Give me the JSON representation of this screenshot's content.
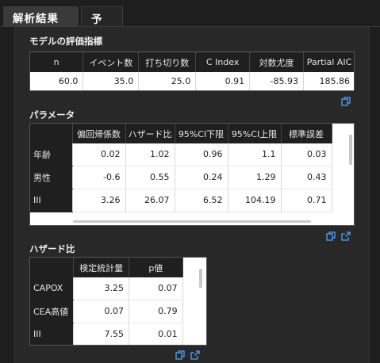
{
  "tabs": [
    {
      "label": "解析結果"
    },
    {
      "label": "予測"
    }
  ],
  "model_metrics": {
    "title": "モデルの評価指標",
    "columns": [
      "n",
      "イベント数",
      "打ち切り数",
      "C Index",
      "対数尤度",
      "Partial AIC"
    ],
    "row": [
      "60.0",
      "35.0",
      "25.0",
      "0.91",
      "-85.93",
      "185.86"
    ]
  },
  "parameters": {
    "title": "パラメータ",
    "columns": [
      "",
      "偏回帰係数",
      "ハザード比",
      "95%CI下限",
      "95%CI上限",
      "標準誤差"
    ],
    "rows": [
      [
        "年齢",
        "0.02",
        "1.02",
        "0.96",
        "1.1",
        "0.03"
      ],
      [
        "男性",
        "-0.6",
        "0.55",
        "0.24",
        "1.29",
        "0.43"
      ],
      [
        "III",
        "3.26",
        "26.07",
        "6.52",
        "104.19",
        "0.71"
      ]
    ]
  },
  "hazard": {
    "title": "ハザード比",
    "columns": [
      "",
      "検定統計量",
      "p値"
    ],
    "rows": [
      [
        "CAPOX",
        "3.25",
        "0.07"
      ],
      [
        "CEA高値",
        "0.07",
        "0.79"
      ],
      [
        "III",
        "7.55",
        "0.01"
      ]
    ]
  },
  "icons": {
    "accent": "#4aa3ff",
    "copy": "copy-icon",
    "open": "open-external-icon"
  }
}
